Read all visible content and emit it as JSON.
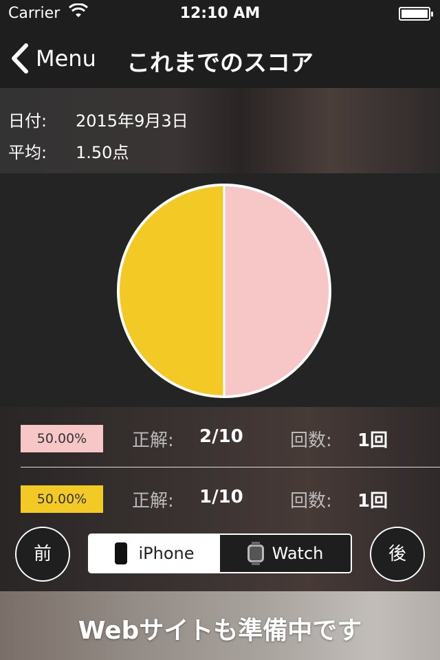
{
  "status_bar": {
    "carrier": "Carrier",
    "time": "12:10 AM"
  },
  "nav": {
    "back_label": "Menu",
    "title": "これまでのスコア"
  },
  "info": {
    "date_label": "日付:",
    "date_value": "2015年9月3日",
    "avg_label": "平均:",
    "avg_value": "1.50点"
  },
  "chart_data": {
    "type": "pie",
    "slices": [
      {
        "label": "50.00%",
        "value": 50,
        "color": "#F7C6C7"
      },
      {
        "label": "50.00%",
        "value": 50,
        "color": "#F2C925"
      }
    ]
  },
  "stats": [
    {
      "percent": "50.00%",
      "color": "#F7C6C7",
      "correct_label": "正解:",
      "correct_value": "2/10",
      "count_label": "回数:",
      "count_value": "1回"
    },
    {
      "percent": "50.00%",
      "color": "#F2C925",
      "correct_label": "正解:",
      "correct_value": "1/10",
      "count_label": "回数:",
      "count_value": "1回"
    }
  ],
  "controls": {
    "prev_label": "前",
    "next_label": "後",
    "segments": [
      {
        "label": "iPhone",
        "icon": "iphone-icon",
        "active": true
      },
      {
        "label": "Watch",
        "icon": "watch-icon",
        "active": false
      }
    ]
  },
  "footer": {
    "text": "Webサイトも準備中です"
  }
}
